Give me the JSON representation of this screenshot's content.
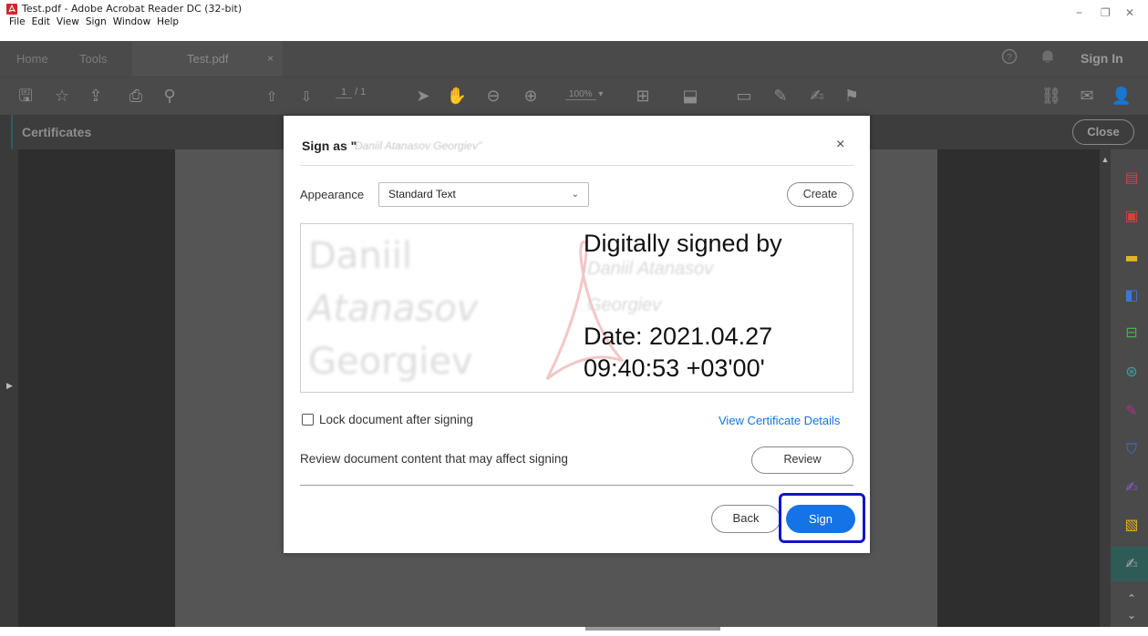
{
  "window": {
    "title": "Test.pdf - Adobe Acrobat Reader DC (32-bit)",
    "minimize": "–",
    "restore": "❐",
    "close": "✕"
  },
  "menu": [
    "File",
    "Edit",
    "View",
    "Sign",
    "Window",
    "Help"
  ],
  "tabs": {
    "home": "Home",
    "tools": "Tools",
    "document": "Test.pdf",
    "close_tab": "×",
    "sign_in": "Sign In"
  },
  "toolbar": {
    "page_current": "1",
    "page_total": "/ 1",
    "zoom": "100%"
  },
  "certificates": {
    "title": "Certificates",
    "close_label": "Close"
  },
  "dialog": {
    "title_prefix": "Sign as \"",
    "signer_blurred": "Daniil Atanasov Georgiev\"",
    "close": "×",
    "appearance_label": "Appearance",
    "appearance_value": "Standard Text",
    "create_label": "Create",
    "preview": {
      "name_lines": [
        "Daniil",
        "Atanasov",
        "Georgiev"
      ],
      "digitally_signed": "Digitally signed by",
      "signer_lines": [
        "Daniil Atanasov",
        "Georgiev"
      ],
      "date_line": "Date: 2021.04.27",
      "time_line": "09:40:53 +03'00'"
    },
    "lock_label": "Lock document after signing",
    "lock_checked": false,
    "view_cert_label": "View Certificate Details",
    "review_text": "Review document content that may affect signing",
    "review_label": "Review",
    "back_label": "Back",
    "sign_label": "Sign"
  },
  "colors": {
    "accent": "#1473e6",
    "highlight": "#1313c8",
    "chrome": "#4a4a4a",
    "active_panel": "#2f5b57"
  },
  "right_panel_icons": [
    "organize-pages-icon",
    "create-pdf-icon",
    "comment-icon",
    "export-pdf-icon",
    "edit-pdf-icon",
    "scan-icon",
    "fill-sign-icon",
    "protect-icon",
    "send-for-signature-icon",
    "more-tools-icon",
    "certificates-icon"
  ]
}
